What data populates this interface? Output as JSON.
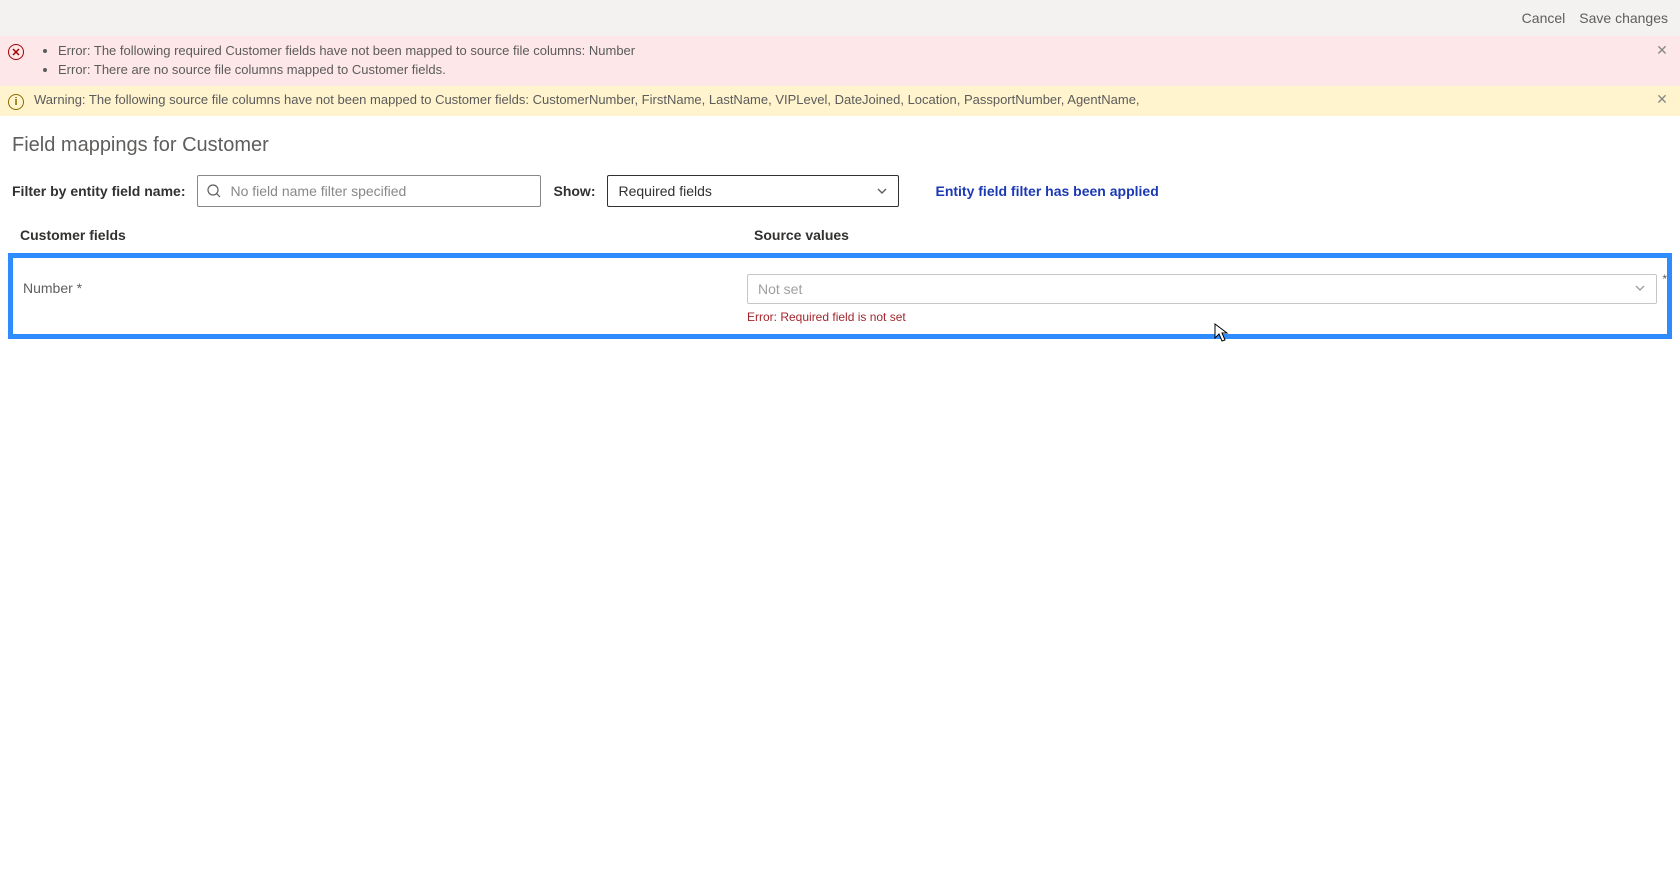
{
  "topbar": {
    "cancel": "Cancel",
    "save": "Save changes"
  },
  "banners": {
    "error": {
      "items": [
        "Error: The following required Customer fields have not been mapped to source file columns: Number",
        "Error: There are no source file columns mapped to Customer fields."
      ]
    },
    "warning": {
      "text": "Warning: The following source file columns have not been mapped to Customer fields: CustomerNumber, FirstName, LastName, VIPLevel, DateJoined, Location, PassportNumber, AgentName,"
    }
  },
  "title": "Field mappings for Customer",
  "filters": {
    "filter_label": "Filter by entity field name:",
    "filter_placeholder": "No field name filter specified",
    "show_label": "Show:",
    "show_value": "Required fields",
    "applied_msg": "Entity field filter has been applied"
  },
  "columns": {
    "left": "Customer fields",
    "right": "Source values"
  },
  "row": {
    "field": "Number *",
    "source_value": "Not set",
    "asterisk": "*",
    "error": "Error: Required field is not set"
  }
}
